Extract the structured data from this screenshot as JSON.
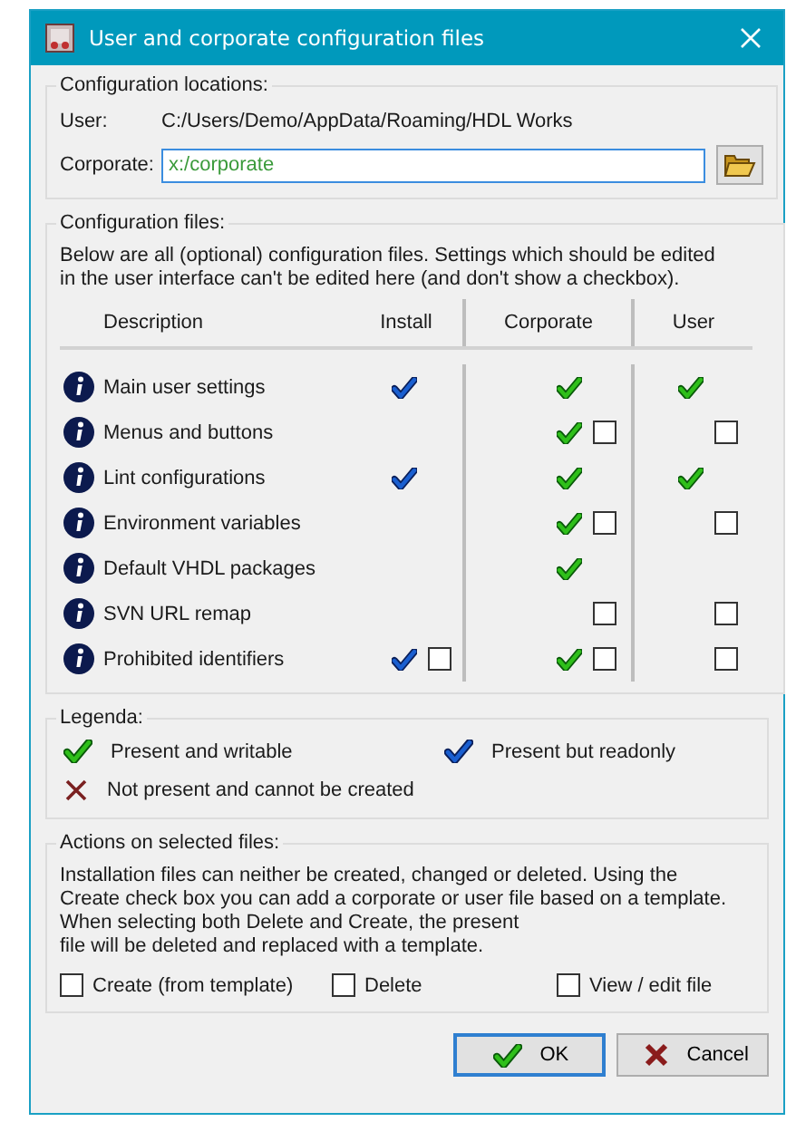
{
  "window": {
    "title": "User and corporate configuration files"
  },
  "locations": {
    "title": "Configuration locations:",
    "user_label": "User:",
    "user_path": "C:/Users/Demo/AppData/Roaming/HDL Works",
    "corporate_label": "Corporate:",
    "corporate_value": "x:/corporate"
  },
  "files": {
    "title": "Configuration files:",
    "description": [
      "Below are all (optional) configuration files. Settings which should be edited",
      "in the user interface can't be edited here (and don't show a checkbox)."
    ],
    "columns": [
      "Description",
      "Install",
      "Corporate",
      "User"
    ],
    "rows": [
      {
        "name": "Main user settings",
        "install": {
          "kind": "readonly"
        },
        "corporate": {
          "kind": "writable"
        },
        "user": {
          "kind": "writable"
        }
      },
      {
        "name": "Menus and buttons",
        "install": {
          "kind": "none"
        },
        "corporate": {
          "kind": "writable",
          "checkbox": {
            "checked": false
          }
        },
        "user": {
          "kind": "none",
          "checkbox": {
            "checked": false
          }
        }
      },
      {
        "name": "Lint configurations",
        "install": {
          "kind": "readonly"
        },
        "corporate": {
          "kind": "writable"
        },
        "user": {
          "kind": "writable"
        }
      },
      {
        "name": "Environment variables",
        "install": {
          "kind": "none"
        },
        "corporate": {
          "kind": "writable",
          "checkbox": {
            "checked": false
          }
        },
        "user": {
          "kind": "none",
          "checkbox": {
            "checked": false
          }
        }
      },
      {
        "name": "Default VHDL packages",
        "install": {
          "kind": "none"
        },
        "corporate": {
          "kind": "writable"
        },
        "user": {
          "kind": "none"
        }
      },
      {
        "name": "SVN URL remap",
        "install": {
          "kind": "none"
        },
        "corporate": {
          "kind": "none",
          "checkbox": {
            "checked": false
          }
        },
        "user": {
          "kind": "none",
          "checkbox": {
            "checked": false
          }
        }
      },
      {
        "name": "Prohibited identifiers",
        "install": {
          "kind": "readonly",
          "checkbox": {
            "checked": false
          }
        },
        "corporate": {
          "kind": "writable",
          "checkbox": {
            "checked": false
          }
        },
        "user": {
          "kind": "none",
          "checkbox": {
            "checked": false
          }
        }
      }
    ]
  },
  "legend": {
    "title": "Legenda:",
    "items": [
      {
        "kind": "writable",
        "label": "Present and writable"
      },
      {
        "kind": "readonly",
        "label": "Present but readonly"
      },
      {
        "kind": "missing",
        "label": "Not present and cannot be created"
      }
    ]
  },
  "actions": {
    "title": "Actions on selected files:",
    "description": [
      "Installation files can neither be created, changed or deleted. Using the",
      "Create check box you can add a corporate or user file based on a template.",
      "When selecting both Delete and Create, the present",
      "file will be deleted and replaced with a template."
    ],
    "options": [
      {
        "label": "Create (from template)",
        "checked": false
      },
      {
        "label": "Delete",
        "checked": false
      },
      {
        "label": "View / edit file",
        "checked": false
      }
    ]
  },
  "buttons": [
    {
      "kind": "ok",
      "label": "OK",
      "default": true
    },
    {
      "kind": "cancel",
      "label": "Cancel",
      "default": false
    }
  ]
}
